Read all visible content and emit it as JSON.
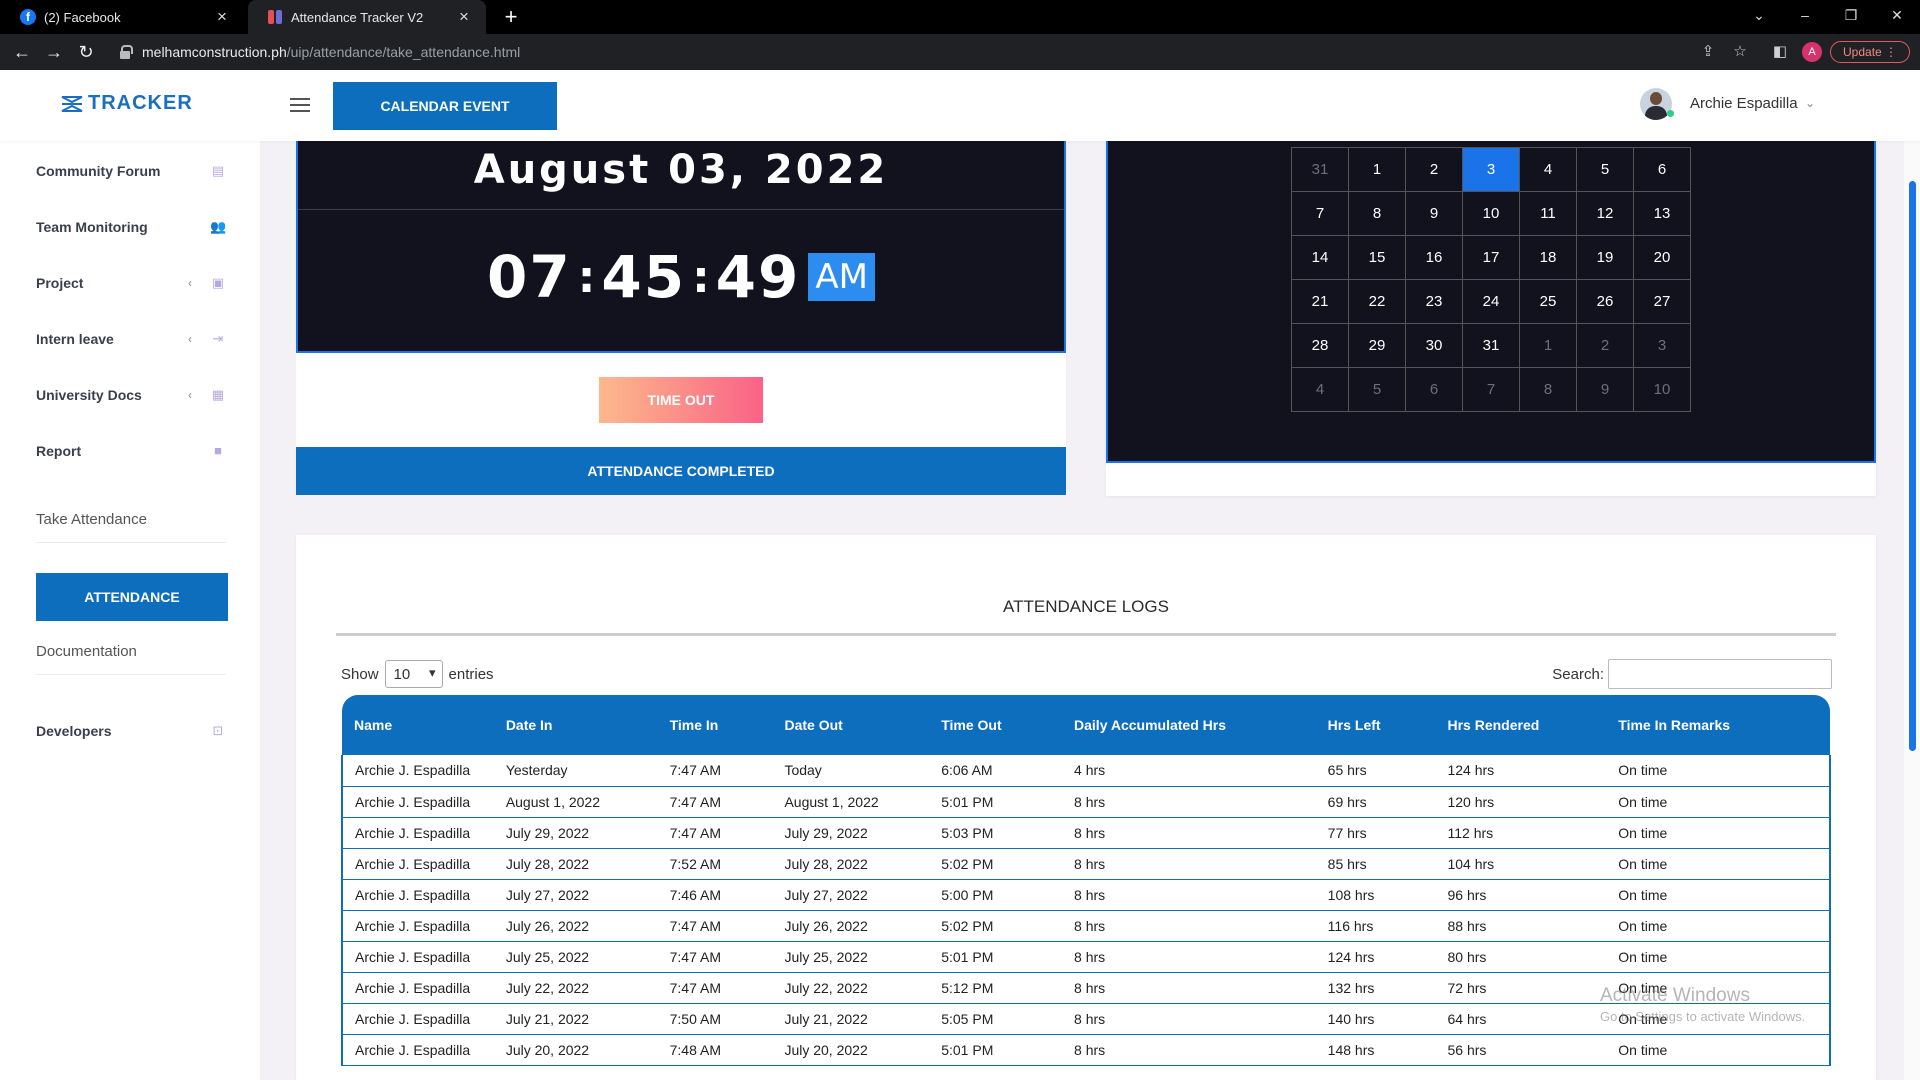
{
  "browser": {
    "tabs": [
      {
        "title": "(2) Facebook"
      },
      {
        "title": "Attendance Tracker V2"
      }
    ],
    "url_host": "melhamconstruction.ph",
    "url_path": "/uip/attendance/take_attendance.html",
    "profile_initial": "A",
    "update_label": "Update"
  },
  "header": {
    "logo_text": "TRACKER",
    "calendar_button": "CALENDAR EVENT",
    "user_name": "Archie Espadilla"
  },
  "sidebar": {
    "items": [
      {
        "label": "Community Forum",
        "icon": "chat-icon"
      },
      {
        "label": "Team Monitoring",
        "icon": "team-icon"
      },
      {
        "label": "Project",
        "icon": "document-icon"
      },
      {
        "label": "Intern leave",
        "icon": "leave-icon"
      },
      {
        "label": "University Docs",
        "icon": "docs-icon"
      },
      {
        "label": "Report",
        "icon": "report-icon"
      }
    ],
    "take_attendance_heading": "Take Attendance",
    "attendance_button": "ATTENDANCE",
    "documentation_heading": "Documentation",
    "developers_label": "Developers"
  },
  "clock": {
    "date": "August 03, 2022",
    "hours": "07",
    "minutes": "45",
    "seconds": "49",
    "ampm": "AM",
    "timeout_button": "TIME OUT",
    "status_bar": "ATTENDANCE COMPLETED"
  },
  "calendar": {
    "weeks": [
      [
        "31",
        "1",
        "2",
        "3",
        "4",
        "5",
        "6"
      ],
      [
        "7",
        "8",
        "9",
        "10",
        "11",
        "12",
        "13"
      ],
      [
        "14",
        "15",
        "16",
        "17",
        "18",
        "19",
        "20"
      ],
      [
        "21",
        "22",
        "23",
        "24",
        "25",
        "26",
        "27"
      ],
      [
        "28",
        "29",
        "30",
        "31",
        "1",
        "2",
        "3"
      ],
      [
        "4",
        "5",
        "6",
        "7",
        "8",
        "9",
        "10"
      ]
    ],
    "today": "3"
  },
  "logs": {
    "title": "ATTENDANCE LOGS",
    "show_label": "Show",
    "entries_value": "10",
    "entries_label": "entries",
    "search_label": "Search:",
    "columns": [
      "Name",
      "Date In",
      "Time In",
      "Date Out",
      "Time Out",
      "Daily Accumulated Hrs",
      "Hrs Left",
      "Hrs Rendered",
      "Time In Remarks"
    ],
    "rows": [
      [
        "Archie J. Espadilla",
        "Yesterday",
        "7:47 AM",
        "Today",
        "6:06 AM",
        "4 hrs",
        "65 hrs",
        "124 hrs",
        "On time"
      ],
      [
        "Archie J. Espadilla",
        "August 1, 2022",
        "7:47 AM",
        "August 1, 2022",
        "5:01 PM",
        "8 hrs",
        "69 hrs",
        "120 hrs",
        "On time"
      ],
      [
        "Archie J. Espadilla",
        "July 29, 2022",
        "7:47 AM",
        "July 29, 2022",
        "5:03 PM",
        "8 hrs",
        "77 hrs",
        "112 hrs",
        "On time"
      ],
      [
        "Archie J. Espadilla",
        "July 28, 2022",
        "7:52 AM",
        "July 28, 2022",
        "5:02 PM",
        "8 hrs",
        "85 hrs",
        "104 hrs",
        "On time"
      ],
      [
        "Archie J. Espadilla",
        "July 27, 2022",
        "7:46 AM",
        "July 27, 2022",
        "5:00 PM",
        "8 hrs",
        "108 hrs",
        "96 hrs",
        "On time"
      ],
      [
        "Archie J. Espadilla",
        "July 26, 2022",
        "7:47 AM",
        "July 26, 2022",
        "5:02 PM",
        "8 hrs",
        "116 hrs",
        "88 hrs",
        "On time"
      ],
      [
        "Archie J. Espadilla",
        "July 25, 2022",
        "7:47 AM",
        "July 25, 2022",
        "5:01 PM",
        "8 hrs",
        "124 hrs",
        "80 hrs",
        "On time"
      ],
      [
        "Archie J. Espadilla",
        "July 22, 2022",
        "7:47 AM",
        "July 22, 2022",
        "5:12 PM",
        "8 hrs",
        "132 hrs",
        "72 hrs",
        "On time"
      ],
      [
        "Archie J. Espadilla",
        "July 21, 2022",
        "7:50 AM",
        "July 21, 2022",
        "5:05 PM",
        "8 hrs",
        "140 hrs",
        "64 hrs",
        "On time"
      ],
      [
        "Archie J. Espadilla",
        "July 20, 2022",
        "7:48 AM",
        "July 20, 2022",
        "5:01 PM",
        "8 hrs",
        "148 hrs",
        "56 hrs",
        "On time"
      ]
    ]
  },
  "watermark": {
    "title": "Activate Windows",
    "subtitle": "Go to Settings to activate Windows."
  },
  "colors": {
    "primary": "#0d6ebe",
    "panel_dark": "#12121f",
    "highlight": "#1a73e8",
    "timeout_gradient_start": "#fcb98c",
    "timeout_gradient_end": "#fb6287"
  }
}
